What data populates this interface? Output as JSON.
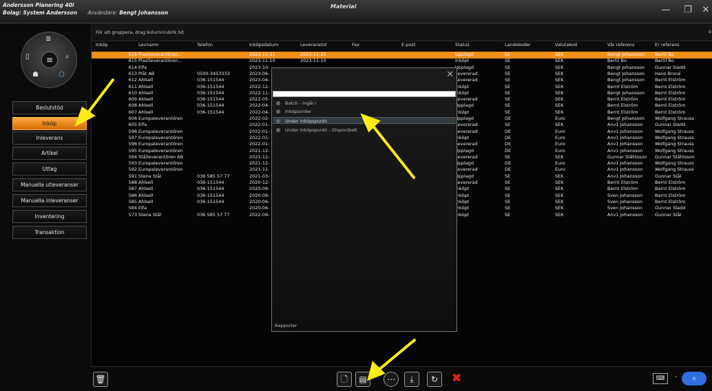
{
  "titlebar": {
    "app": "Andersson Planering 40i",
    "company_label": "Bolag:",
    "company": "System Andersson",
    "user_label": "Användare:",
    "user": "Bengt Johansson",
    "window_title": "Material",
    "min": "—",
    "max": "❐",
    "close": "✕"
  },
  "sidebar": {
    "buttons": [
      "Beslutstöd",
      "Inköp",
      "Inleverans",
      "Artikel",
      "Uttag",
      "Manuella utleveranser",
      "Manuella inleveranser",
      "Inventering",
      "Transaktion"
    ],
    "active": "Inköp"
  },
  "grid": {
    "group_hint": "För att gruppera, drag kolumnrubrik hit",
    "options_icon": "o",
    "columns": [
      "Inköp",
      "Levnamn",
      "Telefon",
      "Inköpsdatum",
      "Leveranstid",
      "Fax",
      "E-post",
      "Status",
      "Landskoder",
      "Valutakod",
      "Vår referens",
      "Er referens"
    ],
    "rows": [
      [
        "616",
        "Plastleverantören...",
        "",
        "2023-11-21",
        "2023-11-21",
        "",
        "",
        "Upplagd",
        "SE",
        "SEK",
        "Bengt Johansson",
        "Bertil Bo"
      ],
      [
        "615",
        "Plastleverantören...",
        "",
        "2023-11-10",
        "2023-11-10",
        "",
        "",
        "Inköpt",
        "SE",
        "SEK",
        "Bertil Bo",
        "Bertil Bo"
      ],
      [
        "614",
        "Elfa",
        "",
        "2023-10-",
        "",
        "",
        "",
        "Upplagd",
        "SE",
        "SEK",
        "Bengt Johansson",
        "Gunnar Sladd"
      ],
      [
        "613",
        "Plåt AB",
        "0500-3453333",
        "2023-06-",
        "",
        "",
        "",
        "Levererad",
        "SE",
        "SEK",
        "Bengt Johansson",
        "Hans Broné"
      ],
      [
        "612",
        "Ahlsell",
        "036-151544",
        "2023-04-",
        "",
        "",
        "",
        "Levererad",
        "SE",
        "SEK",
        "Bengt Johansson",
        "Bernt Elström"
      ],
      [
        "611",
        "Ahlsell",
        "036-151544",
        "2022-12-",
        "",
        "",
        "",
        "Inköpt",
        "SE",
        "SEK",
        "Bernt Elström",
        "Bernt Elström"
      ],
      [
        "610",
        "Ahlsell",
        "036-151544",
        "2022-11-",
        "",
        "",
        "",
        "Inköpt",
        "SE",
        "SEK",
        "Bengt Johansson",
        "Bernt Elström"
      ],
      [
        "609",
        "Ahlsell",
        "036-151544",
        "2022-05-",
        "",
        "",
        "",
        "Levererad",
        "SE",
        "SEK",
        "Bernt Elström",
        "Bernt Elström"
      ],
      [
        "608",
        "Ahlsell",
        "036-151544",
        "2022-04-",
        "",
        "",
        "",
        "Upplagd",
        "SE",
        "SEK",
        "Bernt Elström",
        "Bernt Elström"
      ],
      [
        "607",
        "Ahlsell",
        "036-151544",
        "2022-04-",
        "",
        "",
        "",
        "Inköpt",
        "SE",
        "SEK",
        "Bernt Elström",
        "Bernt Elström"
      ],
      [
        "606",
        "Europaleverantören",
        "",
        "2022-02-",
        "",
        "",
        "",
        "Upplagd",
        "DE",
        "Euro",
        "Bengt Johansson",
        "Wolfgang Strauss"
      ],
      [
        "605",
        "Elfa",
        "",
        "2022-01-",
        "",
        "",
        "",
        "Levererad",
        "SE",
        "SEK",
        "Anv1 Johansson",
        "Gunnar Sladd"
      ],
      [
        "598",
        "Europaleverantören",
        "",
        "2022-01-",
        "",
        "",
        "",
        "Levererad",
        "DE",
        "Euro",
        "Anv1 Johansson",
        "Wolfgang Strauss"
      ],
      [
        "597",
        "Europaleverantören",
        "",
        "2022-01-",
        "",
        "",
        "",
        "Inköpt",
        "DE",
        "Euro",
        "Anv1 Johansson",
        "Wolfgang Strauss"
      ],
      [
        "596",
        "Europaleverantören",
        "",
        "2022-01-",
        "",
        "",
        "",
        "Levererad",
        "DE",
        "Euro",
        "Anv1 Johansson",
        "Wolfgang Strauss"
      ],
      [
        "595",
        "Europaleverantören",
        "",
        "2021-12-",
        "",
        "",
        "",
        "Upplagd",
        "DE",
        "Euro",
        "Anv1 Johansson",
        "Wolfgang Strauss"
      ],
      [
        "594",
        "Stålleverantören AB",
        "",
        "2021-12-",
        "",
        "",
        "",
        "Levererad",
        "SE",
        "SEK",
        "Gunnar Ståhlsson",
        "Gunnar Ståhlsson"
      ],
      [
        "593",
        "Europaleverantören",
        "",
        "2021-12-",
        "",
        "",
        "",
        "Upplagd",
        "DE",
        "Euro",
        "Anv1 Johansson",
        "Wolfgang Strauss"
      ],
      [
        "592",
        "Europaleverantören",
        "",
        "2021-11-",
        "",
        "",
        "",
        "Levererad",
        "DE",
        "Euro",
        "Anv1 Johansson",
        "Wolfgang Strauss"
      ],
      [
        "591",
        "Stena Stål",
        "036 585 57 77",
        "2021-03-",
        "",
        "",
        "",
        "Upplagd",
        "SE",
        "SEK",
        "Anv1 Johansson",
        "Gunnar Stål"
      ],
      [
        "588",
        "Ahlsell",
        "036-151544",
        "2020-12-",
        "",
        "",
        "",
        "Levererad",
        "SE",
        "SEK",
        "Bernt Elström",
        "Bernt Elström"
      ],
      [
        "587",
        "Ahlsell",
        "036-151544",
        "2020-09-",
        "",
        "",
        "",
        "Inköpt",
        "SE",
        "SEK",
        "Bernt Elström",
        "Bernt Elström"
      ],
      [
        "586",
        "Ahlsell",
        "036-151544",
        "2020-06-",
        "",
        "",
        "",
        "Inköpt",
        "SE",
        "SEK",
        "Sven Johansson",
        "Bernt Elström"
      ],
      [
        "585",
        "Ahlsell",
        "036-151544",
        "2020-06-",
        "",
        "",
        "",
        "Inköpt",
        "SE",
        "SEK",
        "Sven Johansson",
        "Bernt Elström"
      ],
      [
        "584",
        "Elfa",
        "",
        "2020-06-",
        "",
        "",
        "",
        "Inköpt",
        "SE",
        "SEK",
        "Sven Johansson",
        "Gunnar Sladd"
      ],
      [
        "573",
        "Stena Stål",
        "036 585 57 77",
        "2022-09-",
        "",
        "",
        "",
        "Inköpt",
        "SE",
        "SEK",
        "Anv1 Johansson",
        "Gunnar Stål"
      ]
    ]
  },
  "popup": {
    "close": "✕",
    "search_value": "",
    "items": [
      "Batch - ingår i",
      "Inköpsorder",
      "Under inköpspunkt",
      "Under inköpspunkt - Disponibelt"
    ],
    "highlighted": "Under inköpspunkt",
    "footer": "Rapporter"
  },
  "toolbar": {
    "delete_icon": "🗑",
    "buttons": [
      "new-document-icon",
      "report-icon",
      "more-icon",
      "download-icon",
      "refresh-icon",
      "delete-x-icon"
    ],
    "glyphs": [
      "🗋",
      "▤",
      "⋯",
      "⤓",
      "↻",
      "✖"
    ],
    "keyboard": "⌨",
    "dash": "-",
    "blue_btn": "ıı"
  },
  "colors": {
    "accent": "#f28e1c",
    "annotation_arrow": "#ffec17",
    "delete": "#e02020"
  }
}
